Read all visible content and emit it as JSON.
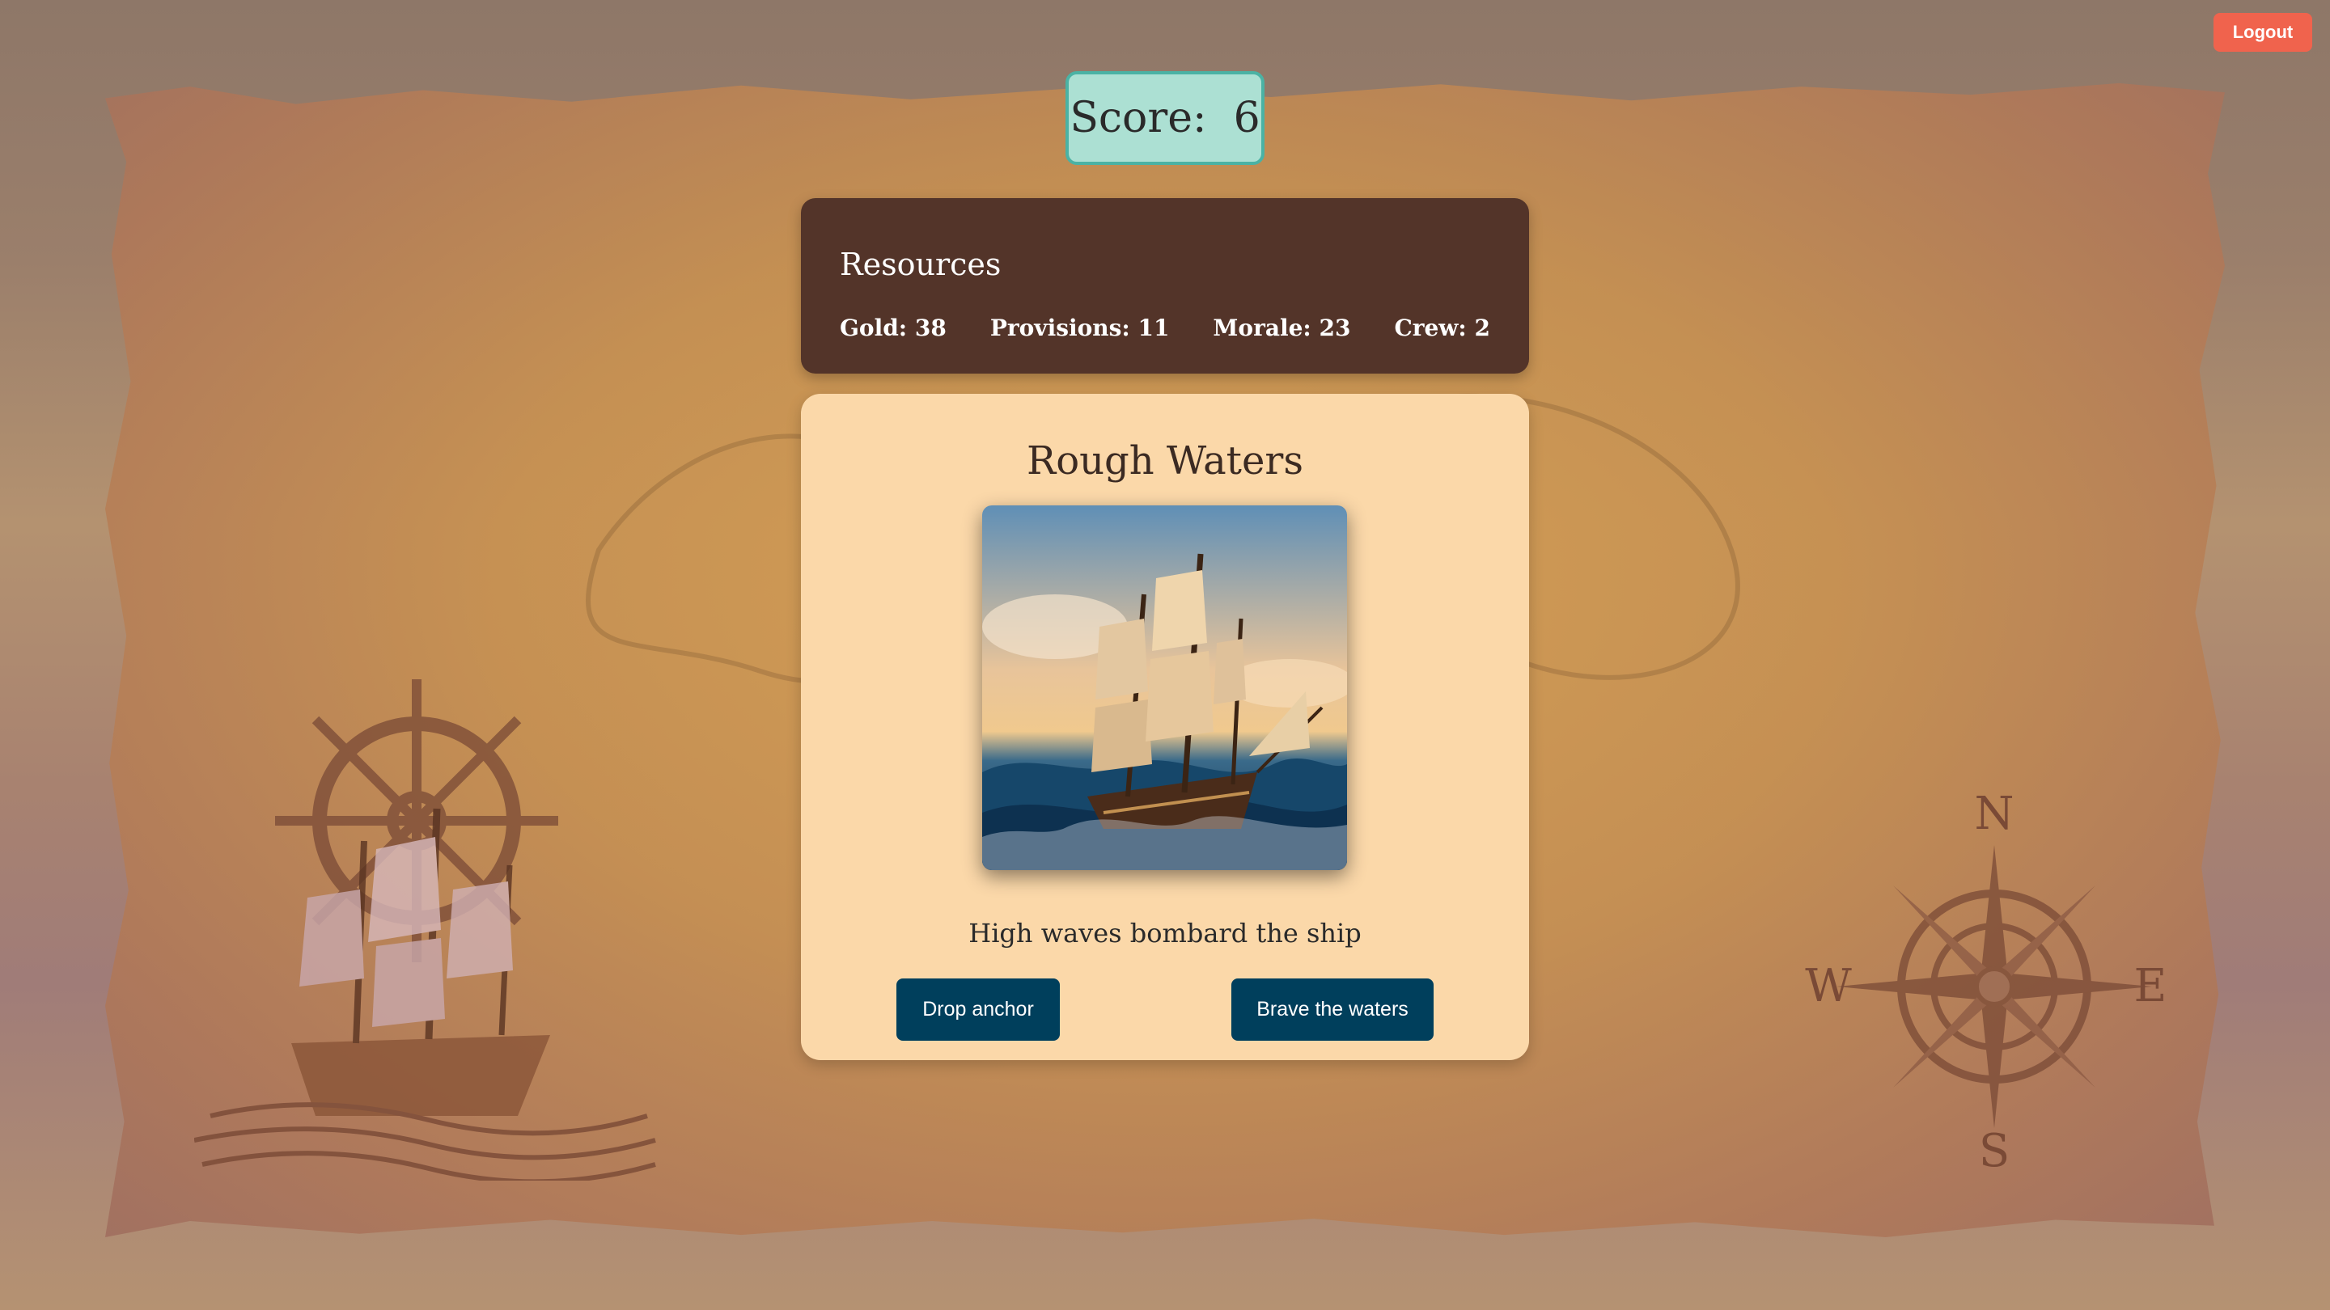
{
  "header": {
    "logout_label": "Logout",
    "score_label": "Score:",
    "score_value": "6"
  },
  "resources": {
    "title": "Resources",
    "items": [
      {
        "label": "Gold:",
        "value": "38"
      },
      {
        "label": "Provisions:",
        "value": "11"
      },
      {
        "label": "Morale:",
        "value": "23"
      },
      {
        "label": "Crew:",
        "value": "2"
      }
    ]
  },
  "event": {
    "title": "Rough Waters",
    "description": "High waves bombard the ship",
    "choices": [
      {
        "label": "Drop anchor"
      },
      {
        "label": "Brave the waters"
      }
    ]
  },
  "compass": {
    "n": "N",
    "s": "S",
    "e": "E",
    "w": "W"
  },
  "colors": {
    "logout": "#f0634d",
    "score_bg": "#ace0d3",
    "score_border": "#4bb2a4",
    "resources_bg": "#533429",
    "card_bg": "#fbd8a9",
    "button_bg": "#003f5c"
  },
  "icons": {
    "ship_wheel": "ship-wheel-icon",
    "sailing_ship": "sailing-ship-icon",
    "compass_rose": "compass-rose-icon"
  }
}
